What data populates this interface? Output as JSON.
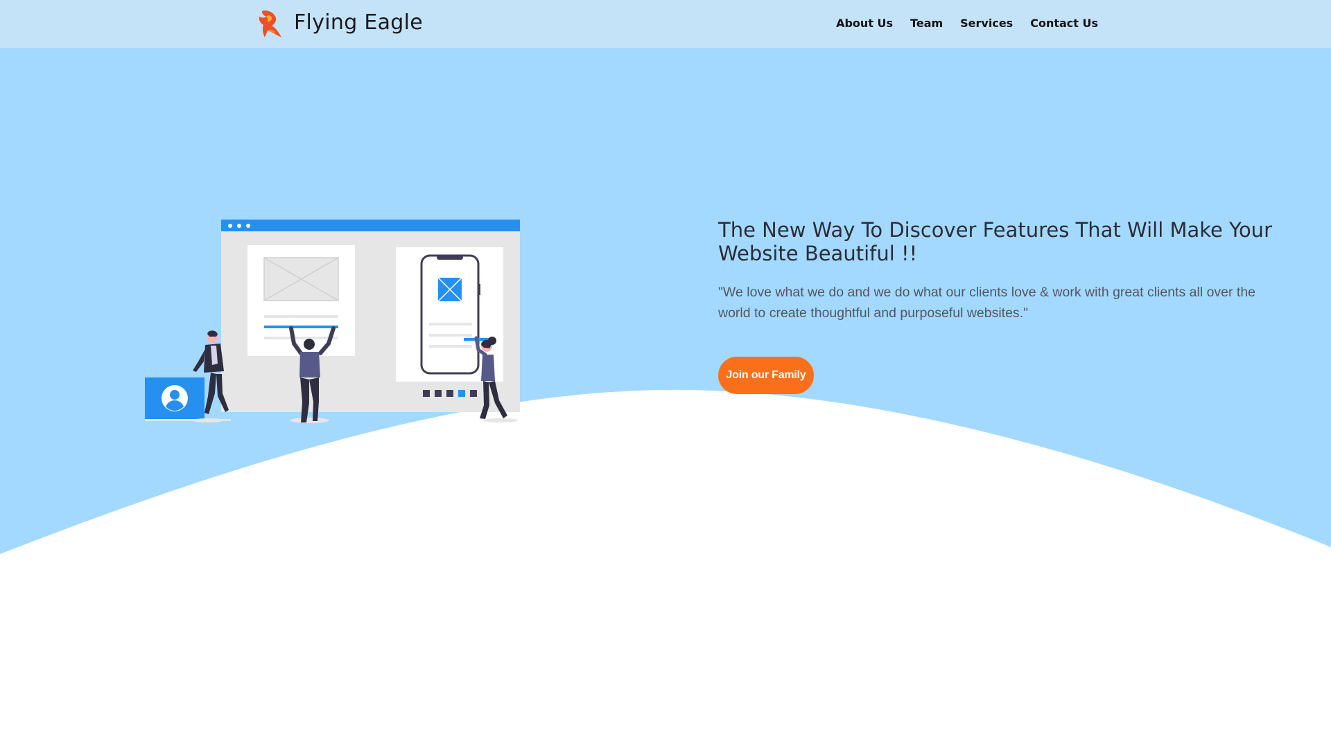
{
  "header": {
    "brand": "Flying Eagle",
    "nav": [
      "About Us",
      "Team",
      "Services",
      "Contact Us"
    ]
  },
  "hero": {
    "title": "The New Way To Discover Features That Will Make Your Website Beautiful !!",
    "quote": "\"We love what we do and we do what our clients love & work with great clients all over the world to create thoughtful and purposeful websites.\"",
    "cta_label": "Join our Family"
  },
  "colors": {
    "header_bg": "#c4e3f8",
    "hero_bg": "#a3d9ff",
    "accent_blue": "#2590f0",
    "cta": "#fa701a"
  },
  "icons": [
    "eagle-logo-icon",
    "user-icon",
    "image-placeholder-icon"
  ]
}
